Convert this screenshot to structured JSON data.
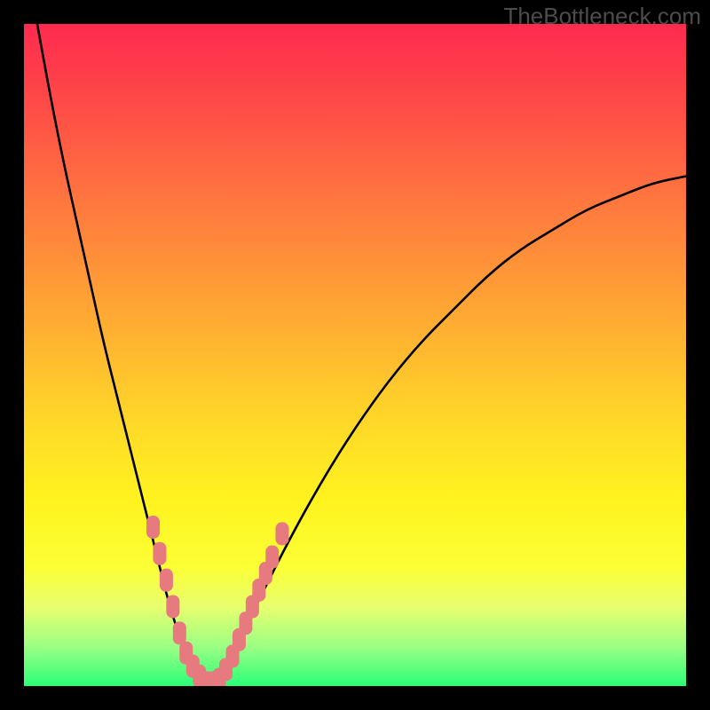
{
  "attribution": "TheBottleneck.com",
  "colors": {
    "page_bg": "#000000",
    "gradient_top": "#ff2a4f",
    "gradient_bottom": "#2bff77",
    "curve": "#000000",
    "marker_fill": "#e77a7f",
    "marker_stroke": "#d86a70"
  },
  "chart_data": {
    "type": "line",
    "title": "",
    "xlabel": "",
    "ylabel": "",
    "xlim": [
      0,
      100
    ],
    "ylim": [
      0,
      100
    ],
    "grid": false,
    "axes_visible": false,
    "series": [
      {
        "name": "bottleneck-curve",
        "x": [
          2,
          4,
          6,
          8,
          10,
          12,
          14,
          16,
          18,
          20,
          22,
          24,
          26,
          28,
          30,
          32,
          36,
          40,
          45,
          50,
          55,
          60,
          65,
          70,
          75,
          80,
          85,
          90,
          95,
          100
        ],
        "y": [
          100,
          89,
          79,
          70,
          61,
          52,
          44,
          36,
          28,
          20,
          12,
          6,
          2,
          0,
          2,
          6,
          14,
          22,
          31,
          39,
          46,
          52,
          57,
          62,
          66,
          69,
          72,
          74,
          76,
          77
        ]
      }
    ],
    "markers": [
      {
        "name": "cluster-left-branch",
        "shape": "rounded-rect",
        "points_xy": [
          [
            19.5,
            24
          ],
          [
            20.5,
            20
          ],
          [
            21.5,
            16
          ],
          [
            22.5,
            12
          ],
          [
            23.5,
            8
          ],
          [
            24.5,
            5
          ],
          [
            25.5,
            3
          ],
          [
            26.5,
            1.5
          ]
        ]
      },
      {
        "name": "cluster-bottom",
        "shape": "rounded-rect",
        "points_xy": [
          [
            27.5,
            0.5
          ],
          [
            28.5,
            0.5
          ],
          [
            29.5,
            1
          ]
        ]
      },
      {
        "name": "cluster-right-branch",
        "shape": "rounded-rect",
        "points_xy": [
          [
            30.5,
            2.5
          ],
          [
            31.5,
            4.5
          ],
          [
            32.5,
            7
          ],
          [
            33.5,
            9.5
          ],
          [
            34.5,
            12
          ],
          [
            35.5,
            14.5
          ],
          [
            36.5,
            17
          ],
          [
            37.5,
            19.5
          ],
          [
            39,
            23
          ]
        ]
      }
    ],
    "background_gradient_stops": [
      {
        "pos": 0.0,
        "color": "#ff2a4f"
      },
      {
        "pos": 0.12,
        "color": "#ff4a47"
      },
      {
        "pos": 0.28,
        "color": "#ff7a3e"
      },
      {
        "pos": 0.44,
        "color": "#ffa933"
      },
      {
        "pos": 0.6,
        "color": "#ffd828"
      },
      {
        "pos": 0.72,
        "color": "#fff31f"
      },
      {
        "pos": 0.82,
        "color": "#fbff35"
      },
      {
        "pos": 0.88,
        "color": "#e8ff6e"
      },
      {
        "pos": 0.94,
        "color": "#9cff84"
      },
      {
        "pos": 1.0,
        "color": "#2bff77"
      }
    ]
  }
}
